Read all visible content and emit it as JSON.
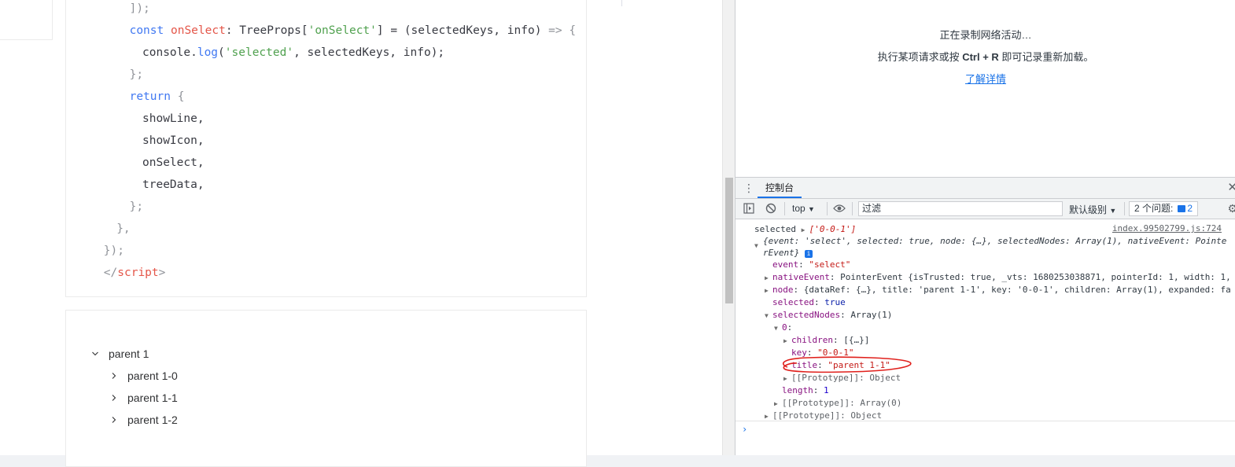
{
  "code": {
    "lines": [
      {
        "segments": [
          {
            "t": "]);",
            "c": "punc"
          }
        ],
        "indent": 4
      },
      {
        "segments": [
          {
            "t": "const ",
            "c": "kw"
          },
          {
            "t": "onSelect",
            "c": "fn"
          },
          {
            "t": ": TreeProps[",
            "c": "ty"
          },
          {
            "t": "'onSelect'",
            "c": "str"
          },
          {
            "t": "] = (selectedKeys, info) ",
            "c": "ty"
          },
          {
            "t": "=> {",
            "c": "punc"
          }
        ],
        "indent": 4
      },
      {
        "segments": [
          {
            "t": "console.",
            "c": "ty"
          },
          {
            "t": "log",
            "c": "kw"
          },
          {
            "t": "(",
            "c": "ty"
          },
          {
            "t": "'selected'",
            "c": "str"
          },
          {
            "t": ", selectedKeys, info);",
            "c": "ty"
          }
        ],
        "indent": 5
      },
      {
        "segments": [
          {
            "t": "};",
            "c": "punc"
          }
        ],
        "indent": 4
      },
      {
        "segments": [
          {
            "t": "return ",
            "c": "kw"
          },
          {
            "t": "{",
            "c": "punc"
          }
        ],
        "indent": 4
      },
      {
        "segments": [
          {
            "t": "showLine,",
            "c": "ty"
          }
        ],
        "indent": 5
      },
      {
        "segments": [
          {
            "t": "showIcon,",
            "c": "ty"
          }
        ],
        "indent": 5
      },
      {
        "segments": [
          {
            "t": "onSelect,",
            "c": "ty"
          }
        ],
        "indent": 5
      },
      {
        "segments": [
          {
            "t": "treeData,",
            "c": "ty"
          }
        ],
        "indent": 5
      },
      {
        "segments": [
          {
            "t": "};",
            "c": "punc"
          }
        ],
        "indent": 4
      },
      {
        "segments": [
          {
            "t": "},",
            "c": "punc"
          }
        ],
        "indent": 3
      },
      {
        "segments": [
          {
            "t": "});",
            "c": "punc"
          }
        ],
        "indent": 2
      },
      {
        "segments": [
          {
            "t": "</",
            "c": "brk"
          },
          {
            "t": "script",
            "c": "tag"
          },
          {
            "t": ">",
            "c": "brk"
          }
        ],
        "indent": 2
      }
    ]
  },
  "tree": {
    "nodes": [
      {
        "label": "parent 1",
        "expanded": true,
        "level": 0
      },
      {
        "label": "parent 1-0",
        "expanded": false,
        "level": 1
      },
      {
        "label": "parent 1-1",
        "expanded": false,
        "level": 1
      },
      {
        "label": "parent 1-2",
        "expanded": false,
        "level": 1
      }
    ]
  },
  "network": {
    "recording": "正在录制网络活动…",
    "hint_prefix": "执行某项请求或按 ",
    "hint_keys": "Ctrl + R",
    "hint_suffix": " 即可记录重新加载。",
    "learn_more": "了解详情"
  },
  "drawer": {
    "tab_label": "控制台",
    "close_icon": "close-icon"
  },
  "toolbar": {
    "context": "top",
    "filter_placeholder": "过滤",
    "levels": "默认级别",
    "issues_label": "2 个问题:",
    "issues_count": "2"
  },
  "console": {
    "log_label": "selected",
    "log_keys": "['0-0-1']",
    "source": "index.99502799.js:724",
    "obj_summary_1": "{event: 'select', selected: true, node: {…}, selectedNodes: Array(1), nativeEvent: Pointe",
    "obj_summary_2": "rEvent}",
    "event_key": "event",
    "event_val": "\"select\"",
    "native_key": "nativeEvent",
    "native_val": "PointerEvent {isTrusted: true, _vts: 1680253038871, pointerId: 1, width: 1,",
    "node_key": "node",
    "node_val": "{dataRef: {…}, title: 'parent 1-1', key: '0-0-1', children: Array(1), expanded: fa",
    "selected_key": "selected",
    "selected_val": "true",
    "sel_nodes_key": "selectedNodes",
    "sel_nodes_val": "Array(1)",
    "zero_key": "0",
    "children_key": "children",
    "children_val": "[{…}]",
    "key_key": "key",
    "key_val": "\"0-0-1\"",
    "title_key": "title",
    "title_val": "\"parent 1-1\"",
    "proto_obj": "[[Prototype]]: Object",
    "length_key": "length",
    "length_val": "1",
    "proto_arr": "[[Prototype]]: Array(0)",
    "proto_obj2": "[[Prototype]]: Object"
  },
  "colors": {
    "accent": "#1a73e8",
    "annotation": "#e0201c"
  }
}
